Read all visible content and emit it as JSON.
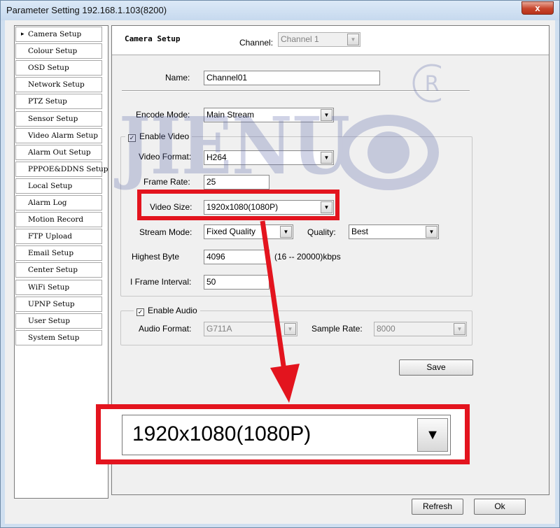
{
  "window": {
    "title": "Parameter Setting 192.168.1.103(8200)",
    "close_glyph": "x"
  },
  "sidebar": {
    "items": [
      {
        "label": "Camera Setup",
        "active": true
      },
      {
        "label": "Colour Setup"
      },
      {
        "label": "OSD Setup"
      },
      {
        "label": "Network Setup"
      },
      {
        "label": "PTZ Setup"
      },
      {
        "label": "Sensor Setup"
      },
      {
        "label": "Video Alarm Setup"
      },
      {
        "label": "Alarm Out Setup"
      },
      {
        "label": "PPPOE&DDNS Setup"
      },
      {
        "label": "Local Setup"
      },
      {
        "label": "Alarm Log"
      },
      {
        "label": "Motion Record"
      },
      {
        "label": "FTP Upload"
      },
      {
        "label": "Email Setup"
      },
      {
        "label": "Center Setup"
      },
      {
        "label": "WiFi Setup"
      },
      {
        "label": "UPNP Setup"
      },
      {
        "label": "User Setup"
      },
      {
        "label": "System Setup"
      }
    ]
  },
  "header": {
    "title": "Camera Setup",
    "channel_label": "Channel:",
    "channel_value": "Channel 1"
  },
  "form": {
    "name_label": "Name:",
    "name_value": "Channel01",
    "encode_mode_label": "Encode Mode:",
    "encode_mode_value": "Main Stream",
    "enable_video_label": "Enable Video",
    "video_format_label": "Video Format:",
    "video_format_value": "H264",
    "frame_rate_label": "Frame Rate:",
    "frame_rate_value": "25",
    "video_size_label": "Video Size:",
    "video_size_value": "1920x1080(1080P)",
    "stream_mode_label": "Stream Mode:",
    "stream_mode_value": "Fixed Quality",
    "quality_label": "Quality:",
    "quality_value": "Best",
    "highest_byte_label": "Highest Byte",
    "highest_byte_value": "4096",
    "highest_byte_range": "(16 -- 20000)kbps",
    "iframe_label": "I Frame Interval:",
    "iframe_value": "50",
    "enable_audio_label": "Enable Audio",
    "audio_format_label": "Audio Format:",
    "audio_format_value": "G711A",
    "sample_rate_label": "Sample Rate:",
    "sample_rate_value": "8000",
    "save_label": "Save"
  },
  "footer": {
    "refresh_label": "Refresh",
    "ok_label": "Ok"
  },
  "zoom": {
    "value": "1920x1080(1080P)"
  },
  "watermark": {
    "text": "JIENU",
    "registered": "R"
  },
  "colors": {
    "highlight": "#e3141e",
    "watermark": "#5a66a8"
  }
}
